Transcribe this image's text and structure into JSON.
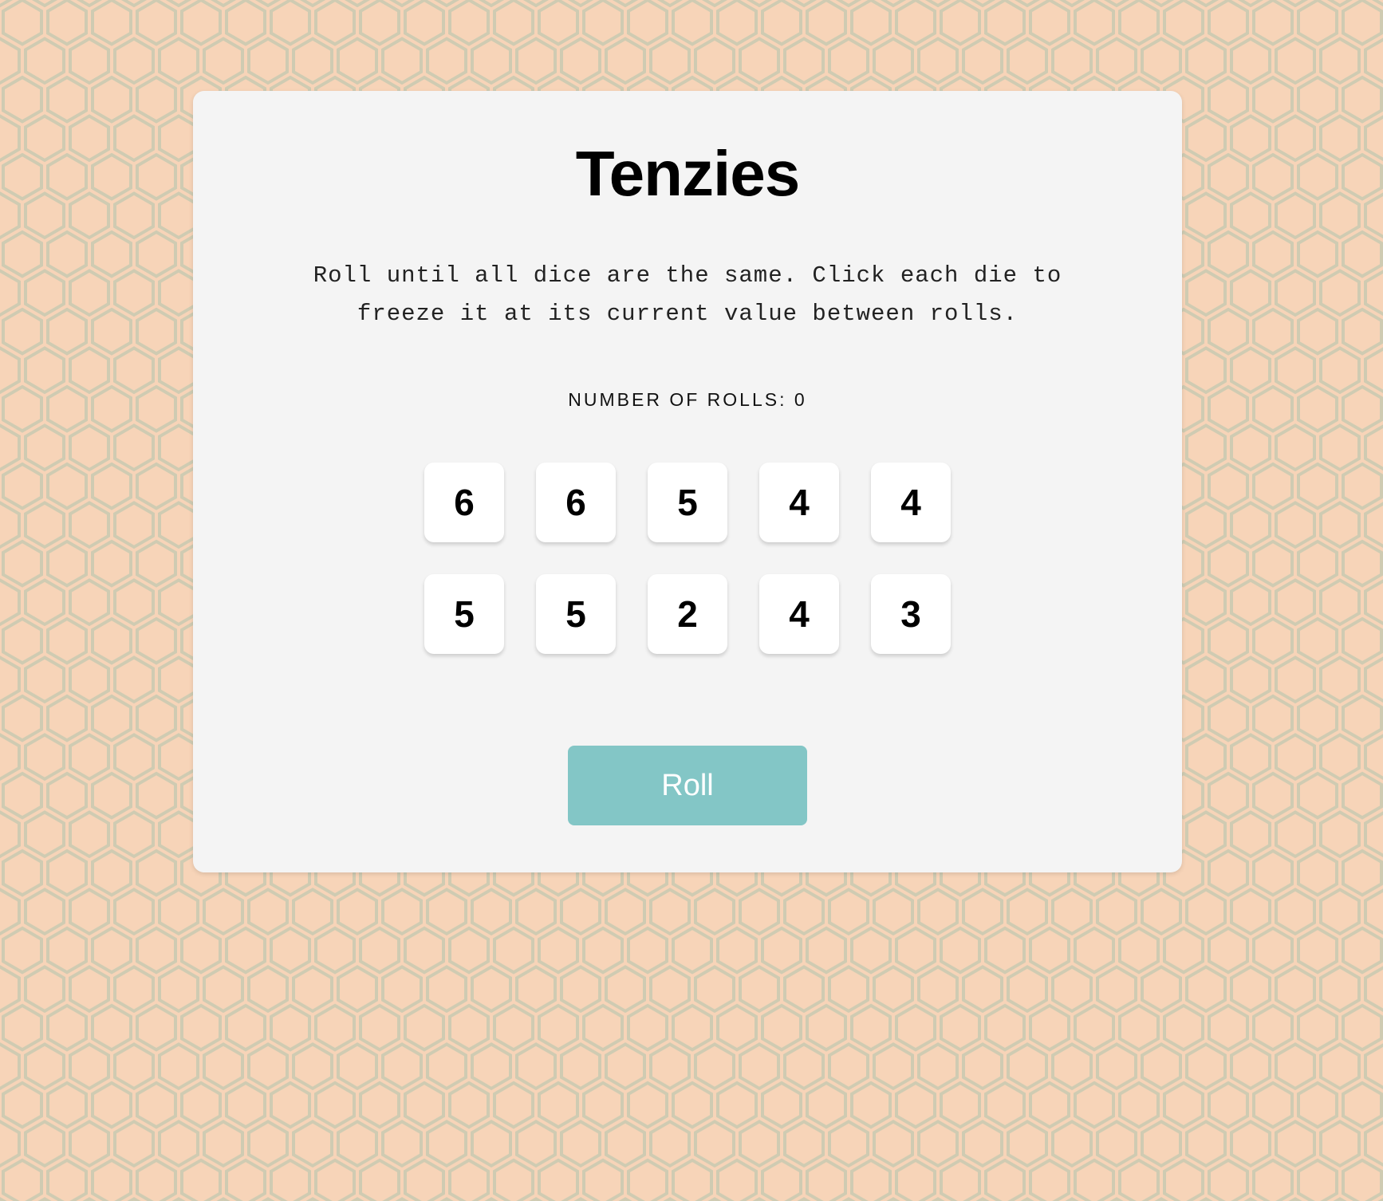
{
  "game": {
    "title": "Tenzies",
    "instructions": "Roll until all dice are the same. Click each die to freeze it at its current value between rolls.",
    "roll_count_label": "NUMBER OF ROLLS: 0",
    "roll_count": 0,
    "dice": [
      {
        "value": "6"
      },
      {
        "value": "6"
      },
      {
        "value": "5"
      },
      {
        "value": "4"
      },
      {
        "value": "4"
      },
      {
        "value": "5"
      },
      {
        "value": "5"
      },
      {
        "value": "2"
      },
      {
        "value": "4"
      },
      {
        "value": "3"
      }
    ],
    "roll_button_label": "Roll"
  },
  "colors": {
    "background": "#f7d4b8",
    "hex_pattern": "#cfcbb2",
    "card": "#f4f4f4",
    "die": "#ffffff",
    "roll_button": "#83c6c6",
    "roll_button_text": "#ffffff"
  }
}
